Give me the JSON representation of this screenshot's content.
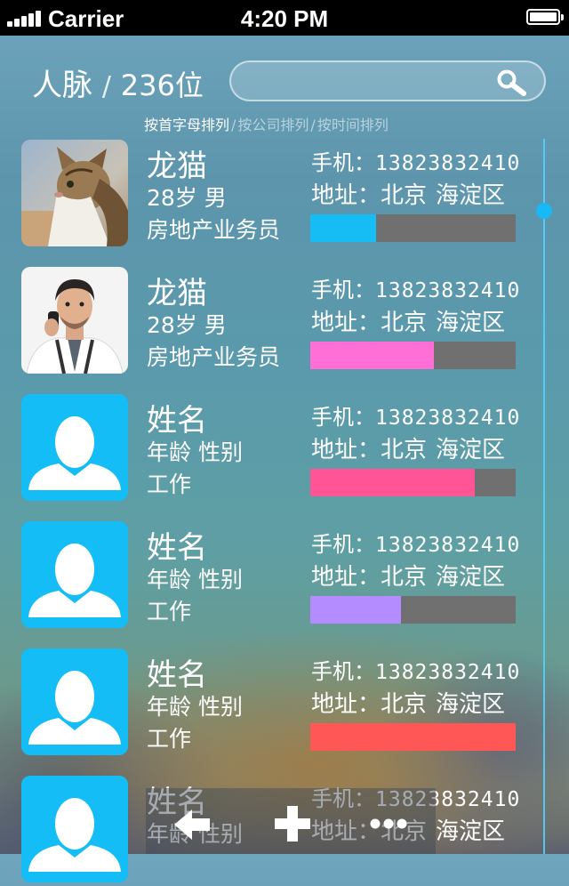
{
  "status_bar": {
    "carrier": "Carrier",
    "time": "4:20 PM"
  },
  "header": {
    "title": "人脉",
    "separator": "/",
    "count": "236位"
  },
  "search": {
    "placeholder": "",
    "icon": "search-icon"
  },
  "sort": {
    "options": [
      "按首字母排列",
      "按公司排列",
      "按时间排列"
    ],
    "selected": "按首字母排列",
    "separator": "/"
  },
  "labels": {
    "phone": "手机：",
    "address": "地址："
  },
  "contacts": [
    {
      "name": "龙猫",
      "age": "28岁",
      "gender": "男",
      "job": "房地产业务员",
      "phone": "13823832410",
      "city": "北京",
      "district": "海淀区",
      "progress": 0.32,
      "color": "#16bdf5",
      "avatar": "cat-photo"
    },
    {
      "name": "龙猫",
      "age": "28岁",
      "gender": "男",
      "job": "房地产业务员",
      "phone": "13823832410",
      "city": "北京",
      "district": "海淀区",
      "progress": 0.6,
      "color": "#ff6fd6",
      "avatar": "man-photo"
    },
    {
      "name": "姓名",
      "age": "年龄",
      "gender": "性别",
      "job": "工作",
      "phone": "13823832410",
      "city": "北京",
      "district": "海淀区",
      "progress": 0.8,
      "color": "#ff5597",
      "avatar": "default-user-icon"
    },
    {
      "name": "姓名",
      "age": "年龄",
      "gender": "性别",
      "job": "工作",
      "phone": "13823832410",
      "city": "北京",
      "district": "海淀区",
      "progress": 0.44,
      "color": "#b48cff",
      "avatar": "default-user-icon"
    },
    {
      "name": "姓名",
      "age": "年龄",
      "gender": "性别",
      "job": "工作",
      "phone": "13823832410",
      "city": "北京",
      "district": "海淀区",
      "progress": 1.0,
      "color": "#ff5656",
      "avatar": "default-user-icon"
    },
    {
      "name": "姓名",
      "age": "年龄",
      "gender": "性别",
      "job": "",
      "phone": "13823832410",
      "city": "北京",
      "district": "海淀区",
      "progress": 0,
      "color": "#16bdf5",
      "avatar": "default-user-icon"
    }
  ],
  "toolbar": {
    "back_icon": "back-arrow-icon",
    "add_icon": "plus-icon",
    "more_icon": "more-dots-icon"
  },
  "colors": {
    "accent": "#19b9f5",
    "bar_track": "#707070"
  }
}
